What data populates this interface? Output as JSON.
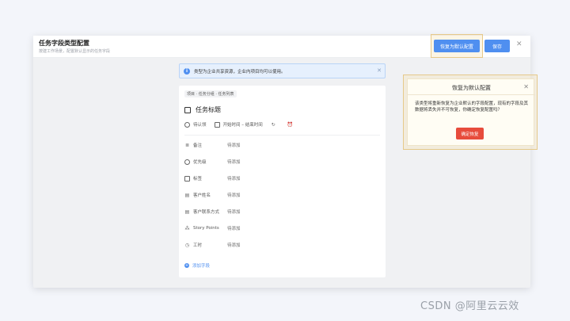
{
  "window": {
    "title": "任务字段类型配置",
    "subtitle": "按建工作场景，配置默认显示的任务字段",
    "restore_label": "恢复为默认配置",
    "save_label": "保存",
    "close_glyph": "✕"
  },
  "notice": {
    "icon": "i",
    "text": "类型为企业共享资源，企业内项目均可以使用。",
    "close_glyph": "✕"
  },
  "card": {
    "breadcrumb": "项目 · 任务分组 · 任务列表",
    "task_title": "任务标题",
    "meta": {
      "assignee": "待认领",
      "time_range": "开始时间 – 结束时间"
    },
    "fields": [
      {
        "icon": "note-icon",
        "glyph": "≣",
        "label": "备注",
        "value": "待添加"
      },
      {
        "icon": "priority-icon",
        "glyph": "",
        "label": "优先级",
        "value": "待添加"
      },
      {
        "icon": "tag-icon",
        "glyph": "",
        "label": "标签",
        "value": "待添加"
      },
      {
        "icon": "customer-name-icon",
        "glyph": "▤",
        "label": "客户姓名",
        "value": "待添加"
      },
      {
        "icon": "customer-contact-icon",
        "glyph": "▤",
        "label": "客户联系方式",
        "value": "待添加"
      },
      {
        "icon": "story-points-icon",
        "glyph": "⁂",
        "label": "Story Points",
        "value": "待添加"
      },
      {
        "icon": "work-hours-icon",
        "glyph": "◷",
        "label": "工时",
        "value": "待添加"
      }
    ],
    "add_field_label": "添加字段"
  },
  "popup": {
    "title": "恢复为默认配置",
    "close_glyph": "✕",
    "body": "该类型将重新恢复为企业默认的字段配置，现有的字段及其数据将丢失并不可恢复，你确定恢复配置吗？",
    "confirm_label": "确定恢复"
  },
  "watermark": "CSDN @阿里云云效",
  "colors": {
    "primary": "#4f8ff0",
    "danger": "#e74c3c",
    "highlight": "#e6c98a"
  }
}
